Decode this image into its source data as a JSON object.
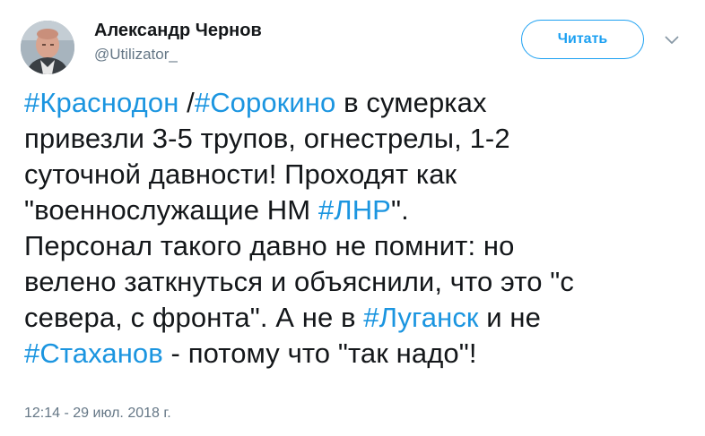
{
  "user": {
    "display_name": "Александр Чернов",
    "handle": "@Utilizator_"
  },
  "follow_button": {
    "label": "Читать"
  },
  "tweet": {
    "lines": [
      [
        {
          "text": "#Краснодон",
          "hashtag": true
        },
        {
          "text": " /",
          "hashtag": false
        },
        {
          "text": "#Сорокино",
          "hashtag": true
        },
        {
          "text": " в сумерках",
          "hashtag": false
        }
      ],
      [
        {
          "text": "привезли 3-5 трупов, огнестрелы, 1-2",
          "hashtag": false
        }
      ],
      [
        {
          "text": "суточной давности! Проходят как",
          "hashtag": false
        }
      ],
      [
        {
          "text": "\"военнослужащие НМ ",
          "hashtag": false
        },
        {
          "text": "#ЛНР",
          "hashtag": true
        },
        {
          "text": "\".",
          "hashtag": false
        }
      ],
      [
        {
          "text": "Персонал такого давно не помнит: но",
          "hashtag": false
        }
      ],
      [
        {
          "text": "велено заткнуться и объяснили, что это \"с",
          "hashtag": false
        }
      ],
      [
        {
          "text": "севера, с фронта\". А не в ",
          "hashtag": false
        },
        {
          "text": "#Луганск",
          "hashtag": true
        },
        {
          "text": " и не",
          "hashtag": false
        }
      ],
      [
        {
          "text": "#Стаханов",
          "hashtag": true
        },
        {
          "text": " - потому что \"так надо\"!",
          "hashtag": false
        }
      ]
    ]
  },
  "timestamp": "12:14 - 29 июл. 2018 г.",
  "icons": {
    "menu": "chevron-down-icon",
    "avatar": "avatar"
  },
  "colors": {
    "accent": "#1da1f2",
    "hashtag": "#1b95e0",
    "text": "#14171a",
    "muted": "#657786"
  }
}
